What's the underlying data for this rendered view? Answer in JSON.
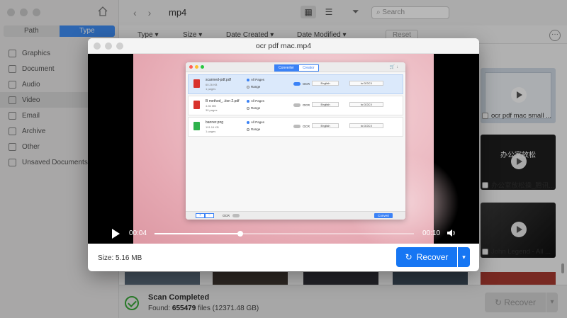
{
  "app": {
    "nav_back": "‹",
    "nav_forward": "›",
    "breadcrumb": "mp4",
    "search_placeholder": "Search",
    "segment": {
      "path": "Path",
      "type": "Type"
    },
    "sidebar": [
      {
        "label": "Graphics",
        "icon": "image-icon"
      },
      {
        "label": "Document",
        "icon": "document-icon"
      },
      {
        "label": "Audio",
        "icon": "audio-icon"
      },
      {
        "label": "Video",
        "icon": "video-icon",
        "active": true
      },
      {
        "label": "Email",
        "icon": "email-icon"
      },
      {
        "label": "Archive",
        "icon": "archive-icon"
      },
      {
        "label": "Other",
        "icon": "other-icon"
      },
      {
        "label": "Unsaved Documents",
        "icon": "unsaved-icon"
      }
    ],
    "filters": {
      "type": "Type",
      "size": "Size",
      "date_created": "Date Created",
      "date_modified": "Date Modified"
    },
    "reset_label": "Reset",
    "more_label": "···",
    "grid_items": [
      {
        "caption": "ocr pdf mac small ..."
      },
      {
        "caption": "办公室放松操_腾讯..."
      },
      {
        "caption": "John Legend - All ..."
      }
    ],
    "thumb2_text": "办公室放松",
    "status": {
      "title": "Scan Completed",
      "found_prefix": "Found: ",
      "found_count": "655479",
      "found_suffix": " files (12371.48 GB)"
    },
    "recover_label": "Recover"
  },
  "modal": {
    "title": "ocr pdf mac.mp4",
    "size_label": "Size: 5.16 MB",
    "recover_label": "Recover",
    "player": {
      "current_time": "00:04",
      "total_time": "00:10",
      "progress": 0.33
    },
    "video_frame": {
      "tabs": {
        "converter": "Converter",
        "creator": "Creator"
      },
      "files": [
        {
          "name": "scanned-pdf.pdf",
          "size": "60.26 KB",
          "pages": "1 pages",
          "ocr_on": true,
          "language": "English",
          "output": "to DOCX",
          "icon_color": "#d8322c"
        },
        {
          "name": "B method_..tion 2.pdf",
          "size": "4.56 MB",
          "pages": "30 pages",
          "ocr_on": false,
          "language": "English",
          "output": "to DOCX",
          "icon_color": "#d8322c"
        },
        {
          "name": "banner.png",
          "size": "191.16 KB",
          "pages": "1 pages",
          "ocr_on": false,
          "language": "English",
          "output": "to DOCX",
          "icon_color": "#2eb24c"
        }
      ],
      "option_all": "All Pages",
      "option_range": "Range",
      "ocr_label": "OCR",
      "add_remove": [
        "+",
        "−"
      ],
      "convert_label": "Convert"
    }
  }
}
